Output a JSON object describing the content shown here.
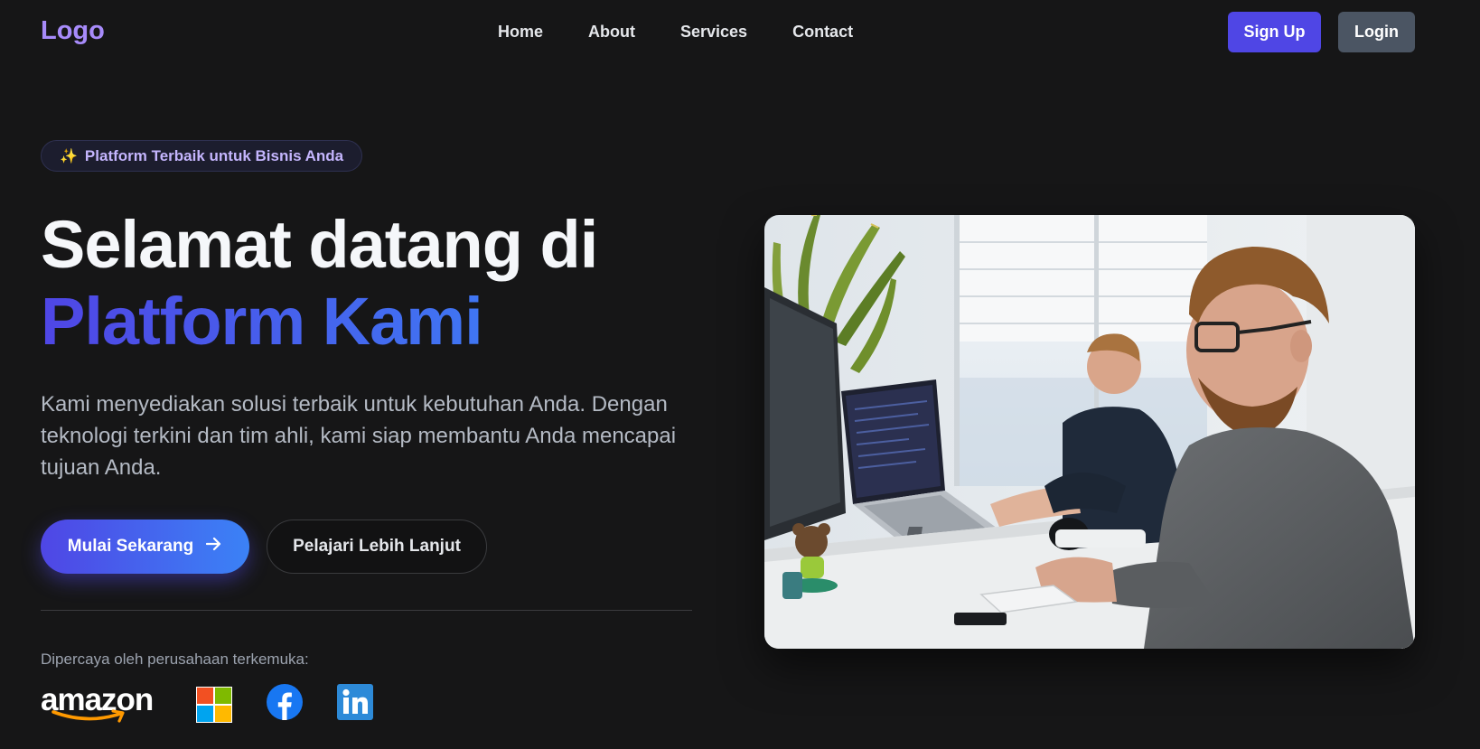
{
  "navbar": {
    "logo": "Logo",
    "links": [
      "Home",
      "About",
      "Services",
      "Contact"
    ],
    "signup_label": "Sign Up",
    "login_label": "Login"
  },
  "hero": {
    "badge_icon": "✨",
    "badge_text": "Platform Terbaik untuk Bisnis Anda",
    "title_line1": "Selamat datang di",
    "title_line2": "Platform Kami",
    "description": "Kami menyediakan solusi terbaik untuk kebutuhan Anda. Dengan teknologi terkini dan tim ahli, kami siap membantu Anda mencapai tujuan Anda.",
    "primary_cta": "Mulai Sekarang",
    "secondary_cta": "Pelajari Lebih Lanjut",
    "trusted_label": "Dipercaya oleh perusahaan terkemuka:",
    "partners": [
      "amazon",
      "microsoft-logo",
      "facebook-logo",
      "linkedin-logo"
    ],
    "amazon_wordmark": "amazon",
    "image_subject": "two men working at computers in a bright office"
  },
  "colors": {
    "background": "#161617",
    "accent": "#4f46e5",
    "accent_gradient_end": "#3b82f6",
    "logo": "#a78bfa",
    "login_button": "#4b5563"
  }
}
